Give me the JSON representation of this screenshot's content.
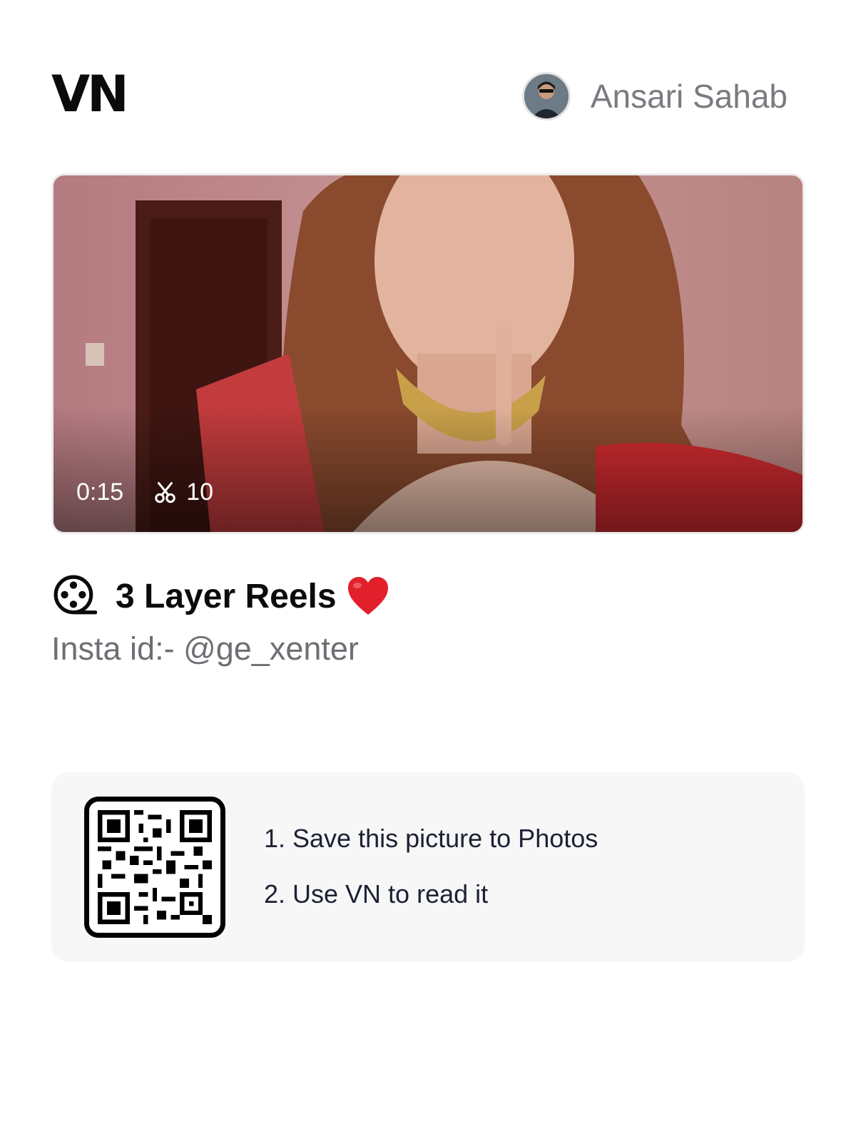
{
  "header": {
    "logo_text": "VN",
    "user_name": "Ansari Sahab",
    "avatar_icon": "user-avatar"
  },
  "video": {
    "duration": "0:15",
    "clip_count": "10",
    "cut_icon": "scissors-icon"
  },
  "project": {
    "icon": "film-reel-icon",
    "title": "3 Layer Reels",
    "title_emoji": "heart-icon",
    "description": "Insta id:- @ge_xenter"
  },
  "qr_panel": {
    "step_1": "1. Save this picture to Photos",
    "step_2": "2. Use VN to read it"
  },
  "colors": {
    "heart": "#e2202b",
    "muted_text": "#6e6e74",
    "card_bg": "#f7f7f8"
  }
}
